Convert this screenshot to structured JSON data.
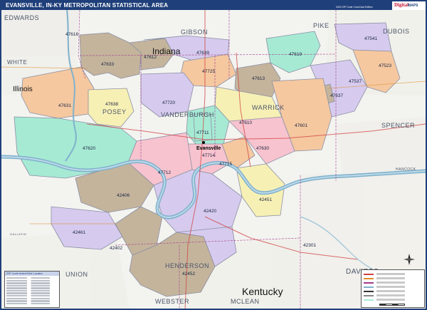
{
  "header": {
    "title": "EVANSVILLE, IN-KY METROPOLITAN STATISTICAL AREA",
    "edition": "2020 ZIP Code ColorCast Edition",
    "logo_brand": "Digital",
    "logo_sub": "MAPS"
  },
  "states": [
    "Indiana",
    "Illinois",
    "Kentucky"
  ],
  "counties": [
    "EDWARDS",
    "WHITE",
    "GIBSON",
    "PIKE",
    "DUBOIS",
    "POSEY",
    "VANDERBURGH",
    "WARRICK",
    "SPENCER",
    "HENDERSON",
    "UNION",
    "WEBSTER",
    "MCLEAN",
    "DAVIESS",
    "HANCOCK",
    "GALLATIN"
  ],
  "city": "Evansville",
  "zips": [
    "47616",
    "47612",
    "47639",
    "47619",
    "47541",
    "47523",
    "47633",
    "47725",
    "47613",
    "47637",
    "47537",
    "47631",
    "47638",
    "47720",
    "47610",
    "47601",
    "47711",
    "47620",
    "47714",
    "47715",
    "47630",
    "47712",
    "42406",
    "42451",
    "42420",
    "42461",
    "42402",
    "42301",
    "42452"
  ],
  "legend": {
    "heading": "ZIP Code Index/Grid Locator"
  },
  "colors": {
    "teal": "#a6ead4",
    "peach": "#f5c8a0",
    "lavender": "#d6cbee",
    "tan": "#c4b49c",
    "pink": "#f7c3cf",
    "yellow": "#f7f0b5",
    "river": "#7fb1cc",
    "frame": "#1f3f7a"
  }
}
